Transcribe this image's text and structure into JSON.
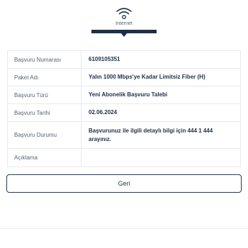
{
  "tab": {
    "label": "Internet",
    "icon": "wifi-icon",
    "accent": "#1f2f45"
  },
  "details": {
    "rows": [
      {
        "label": "Başvuru Numarası",
        "value": "6109105351"
      },
      {
        "label": "Paket Adı",
        "value": "Yalın 1000 Mbps'ye Kadar Limitsiz Fiber (H)"
      },
      {
        "label": "Başvuru Türü",
        "value": "Yeni Abonelik Başvuru Talebi"
      },
      {
        "label": "Başvuru Tarihi",
        "value": "02.06.2024"
      },
      {
        "label": "Başvuru Durumu",
        "value": "Başvurunuz ile ilgili detaylı bilgi için 444 1 444 arayınız."
      },
      {
        "label": "Açıklama",
        "value": ""
      }
    ]
  },
  "actions": {
    "back_label": "Geri"
  }
}
